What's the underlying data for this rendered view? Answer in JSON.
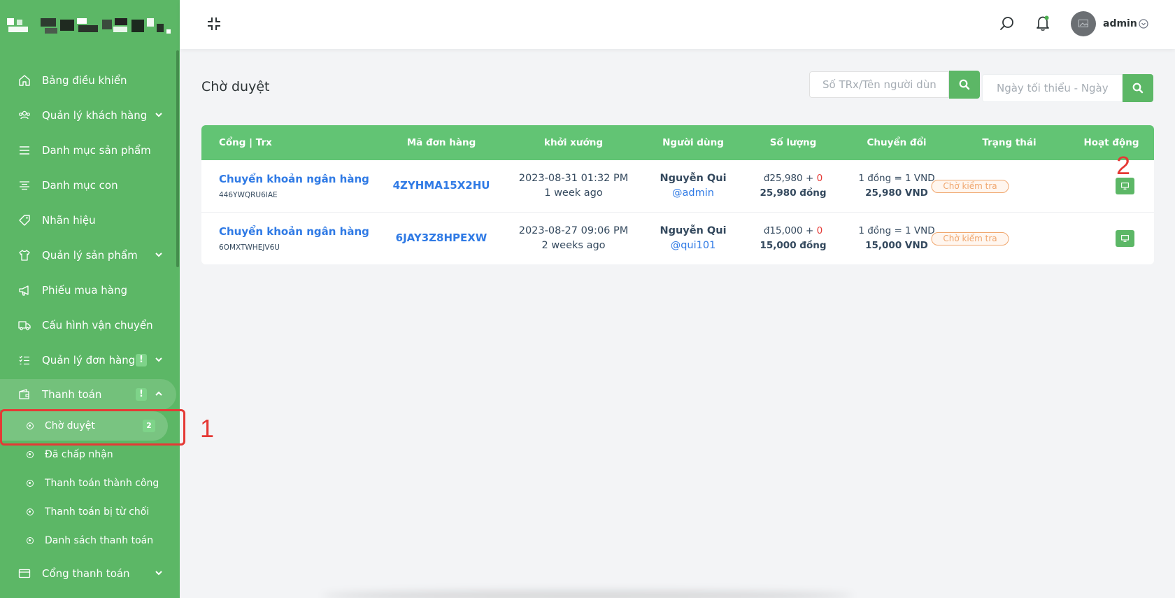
{
  "sidebar": {
    "items": [
      {
        "label": "Bảng điều khiển"
      },
      {
        "label": "Quản lý khách hàng"
      },
      {
        "label": "Danh mục sản phẩm"
      },
      {
        "label": "Danh mục con"
      },
      {
        "label": "Nhãn hiệu"
      },
      {
        "label": "Quản lý sản phẩm"
      },
      {
        "label": "Phiếu mua hàng"
      },
      {
        "label": "Cấu hình vận chuyển"
      },
      {
        "label": "Quản lý đơn hàng",
        "alert": "!"
      },
      {
        "label": "Thanh toán",
        "alert": "!"
      },
      {
        "label": "Cổng thanh toán"
      }
    ],
    "payment_sub": [
      {
        "label": "Chờ duyệt",
        "badge": "2"
      },
      {
        "label": "Đã chấp nhận"
      },
      {
        "label": "Thanh toán thành công"
      },
      {
        "label": "Thanh toán bị từ chối"
      },
      {
        "label": "Danh sách thanh toán"
      }
    ]
  },
  "header": {
    "user_name": "admin"
  },
  "annotations": {
    "one": "1",
    "two": "2"
  },
  "page": {
    "title": "Chờ duyệt",
    "search_placeholder": "Số TRx/Tên người dùng",
    "date_placeholder": "Ngày tối thiểu - Ngày tối đa"
  },
  "table": {
    "headers": [
      "Cổng | Trx",
      "Mã đơn hàng",
      "khởi xướng",
      "Người dùng",
      "Số lượng",
      "Chuyển đổi",
      "Trạng thái",
      "Hoạt động"
    ],
    "rows": [
      {
        "gateway": "Chuyển khoản ngân hàng",
        "trx": "446YWQRU6IAE",
        "order_code": "4ZYHMA15X2HU",
        "date": "2023-08-31 01:32 PM",
        "ago": "1 week ago",
        "user_name": "Nguyễn Qui",
        "username": "@admin",
        "amount": "đ25,980",
        "plus": " + ",
        "charge": "0",
        "amount_total": "25,980 đồng",
        "rate": "1 đồng = 1 VND",
        "converted": "25,980 VND",
        "status": "Chờ kiểm tra"
      },
      {
        "gateway": "Chuyển khoản ngân hàng",
        "trx": "6OMXTWHEJV6U",
        "order_code": "6JAY3Z8HPEXW",
        "date": "2023-08-27 09:06 PM",
        "ago": "2 weeks ago",
        "user_name": "Nguyễn Qui",
        "username": "@qui101",
        "amount": "đ15,000",
        "plus": " + ",
        "charge": "0",
        "amount_total": "15,000 đồng",
        "rate": "1 đồng = 1 VND",
        "converted": "15,000 VND",
        "status": "Chờ kiểm tra"
      }
    ]
  },
  "colors": {
    "sidebar": "#5cb766",
    "table_header": "#62c474",
    "link": "#2f7ae5",
    "status": "#f0a66d",
    "annotation": "#e53935"
  }
}
